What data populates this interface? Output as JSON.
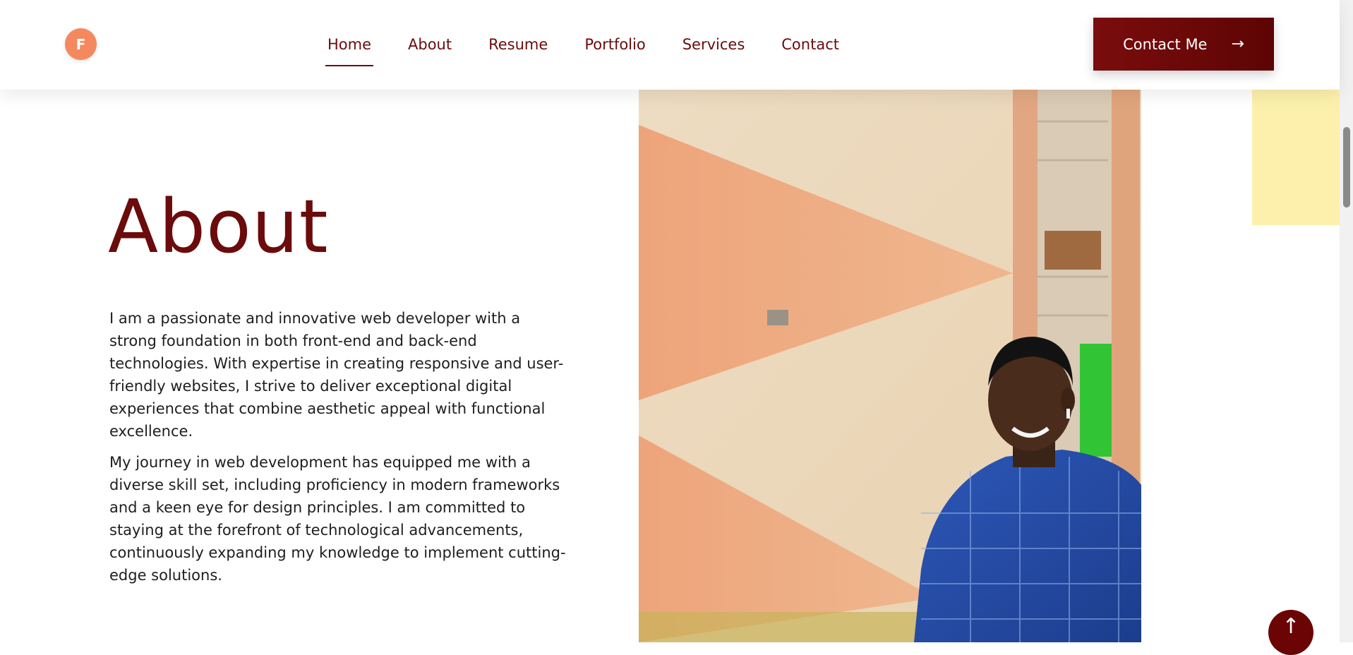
{
  "header": {
    "logo_letter": "F",
    "nav": [
      {
        "label": "Home",
        "active": true
      },
      {
        "label": "About"
      },
      {
        "label": "Resume"
      },
      {
        "label": "Portfolio"
      },
      {
        "label": "Services"
      },
      {
        "label": "Contact"
      }
    ],
    "cta_label": "Contact Me",
    "cta_icon": "arrow-right-icon"
  },
  "about": {
    "title": "About",
    "paragraphs": [
      "I am a passionate and innovative web developer with a strong foundation in both front-end and back-end technologies. With expertise in creating responsive and user-friendly websites, I strive to deliver exceptional digital experiences that combine aesthetic appeal with functional excellence.",
      "My journey in web development has equipped me with a diverse skill set, including proficiency in modern frameworks and a keen eye for design principles. I am committed to staying at the forefront of technological advancements, continuously expanding my knowledge to implement cutting-edge solutions."
    ]
  },
  "back_to_top_icon": "arrow-up-icon",
  "colors": {
    "brand": "#6b0b0b",
    "logo": "#f4895f",
    "accent_yellow": "#fdf0ac"
  }
}
